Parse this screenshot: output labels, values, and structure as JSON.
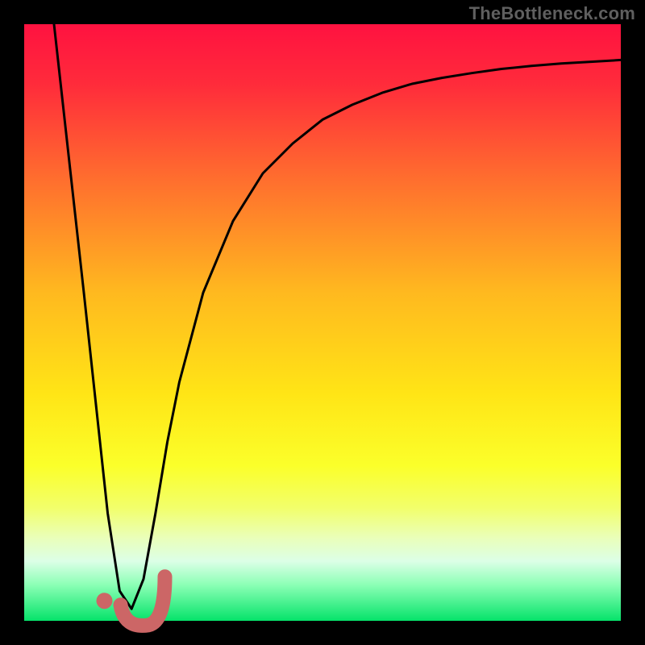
{
  "meta": {
    "watermark": "TheBottleneck.com"
  },
  "chart_data": {
    "type": "line",
    "title": "",
    "xlabel": "",
    "ylabel": "",
    "xlim": [
      0,
      100
    ],
    "ylim": [
      0,
      100
    ],
    "grid": false,
    "background": "red-yellow-green vertical gradient",
    "annotations": [
      "hook-shaped marker near curve minimum"
    ],
    "series": [
      {
        "name": "bottleneck-curve",
        "color": "#000000",
        "x": [
          5,
          10,
          14,
          16,
          18,
          20,
          22,
          24,
          26,
          30,
          35,
          40,
          45,
          50,
          55,
          60,
          65,
          70,
          75,
          80,
          85,
          90,
          95,
          100
        ],
        "y": [
          100,
          55,
          18,
          5,
          2,
          7,
          18,
          30,
          40,
          55,
          67,
          75,
          80,
          84,
          86.5,
          88.5,
          90,
          91,
          91.8,
          92.5,
          93,
          93.4,
          93.7,
          94
        ]
      }
    ],
    "optimum": {
      "x": 17.5,
      "y": 2
    }
  }
}
